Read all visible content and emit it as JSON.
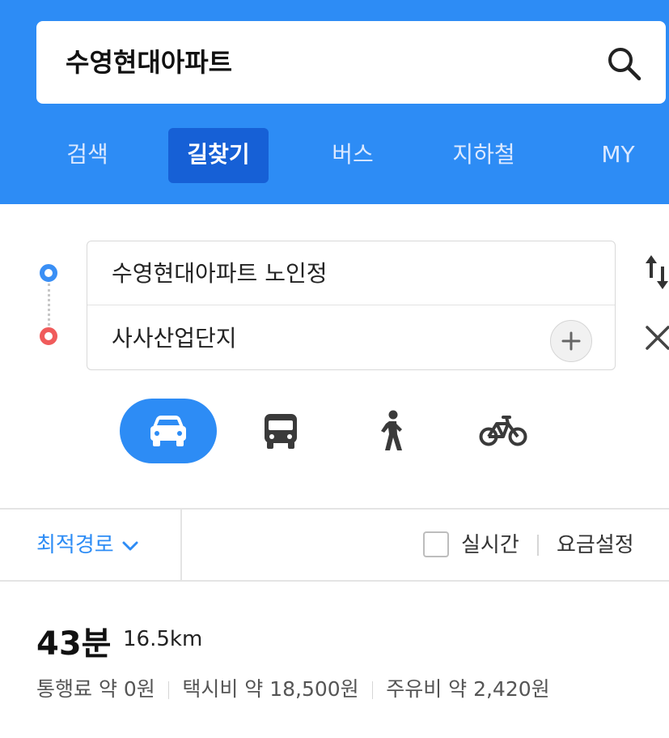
{
  "search": {
    "query": "수영현대아파트",
    "icon": "search-icon"
  },
  "nav": {
    "tabs": [
      "검색",
      "길찾기",
      "버스",
      "지하철",
      "MY"
    ],
    "active_index": 1
  },
  "route": {
    "origin": "수영현대아파트 노인정",
    "destination": "사사산업단지"
  },
  "modes": [
    {
      "name": "car",
      "icon": "car-icon",
      "active": true
    },
    {
      "name": "bus",
      "icon": "bus-icon",
      "active": false
    },
    {
      "name": "walk",
      "icon": "walking-icon",
      "active": false
    },
    {
      "name": "bike",
      "icon": "bicycle-icon",
      "active": false
    }
  ],
  "options": {
    "route_type": "최적경로",
    "realtime_label": "실시간",
    "realtime_checked": false,
    "fare_setting": "요금설정"
  },
  "result": {
    "duration": "43분",
    "distance": "16.5km",
    "toll": "통행료 약 0원",
    "taxi": "택시비 약 18,500원",
    "fuel": "주유비 약 2,420원"
  },
  "colors": {
    "brand_blue": "#2d8cf5",
    "active_tab": "#1660d6",
    "origin_dot": "#3a8ff5",
    "destination_dot": "#f05b5b"
  }
}
